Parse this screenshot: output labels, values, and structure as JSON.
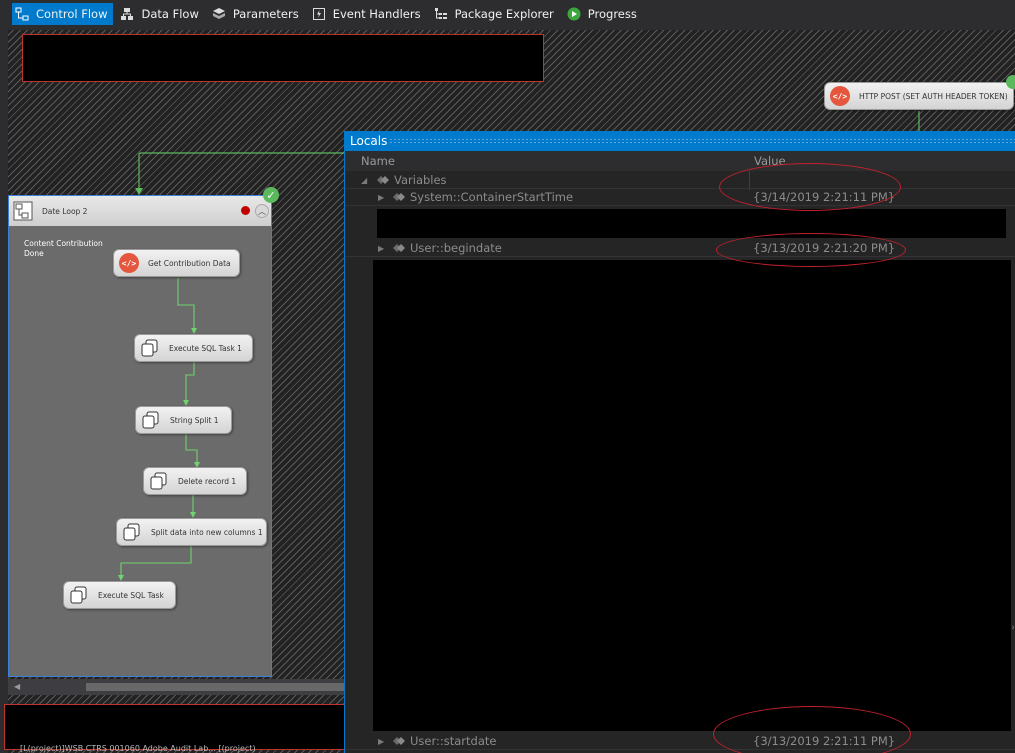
{
  "toolbar": {
    "tabs": [
      {
        "label": "Control Flow",
        "icon": "control-flow-icon",
        "active": true
      },
      {
        "label": "Data Flow",
        "icon": "data-flow-icon",
        "active": false
      },
      {
        "label": "Parameters",
        "icon": "parameters-icon",
        "active": false
      },
      {
        "label": "Event Handlers",
        "icon": "event-handlers-icon",
        "active": false
      },
      {
        "label": "Package Explorer",
        "icon": "package-explorer-icon",
        "active": false
      },
      {
        "label": "Progress",
        "icon": "progress-icon",
        "active": false
      }
    ]
  },
  "canvas": {
    "http_task_label": "HTTP POST (SET AUTH HEADER TOKEN)",
    "container": {
      "title": "Date Loop 2",
      "note_line1": "Content Contribution",
      "note_line2": "Done",
      "tasks": [
        "Get Contribution Data",
        "Execute SQL Task 1",
        "String Split 1",
        "Delete record 1",
        "Split data into new columns 1",
        "Execute SQL Task"
      ]
    },
    "status_text": "[L(project)]WSB CTRS 001060 Adobe Audit  Lab... [(project)"
  },
  "locals": {
    "title": "Locals",
    "col_name": "Name",
    "col_value": "Value",
    "rows": [
      {
        "name": "Variables",
        "value": ""
      },
      {
        "name": "System::ContainerStartTime",
        "value": "{3/14/2019 2:21:11 PM}"
      },
      {
        "name": "User::begindate",
        "value": "{3/13/2019 2:21:20 PM}"
      },
      {
        "name": "User::startdate",
        "value": "{3/13/2019 2:21:11 PM}"
      }
    ]
  },
  "colors": {
    "accent": "#007acc",
    "success": "#5cb85c",
    "error": "#c00000",
    "annotation": "#c0212b"
  }
}
